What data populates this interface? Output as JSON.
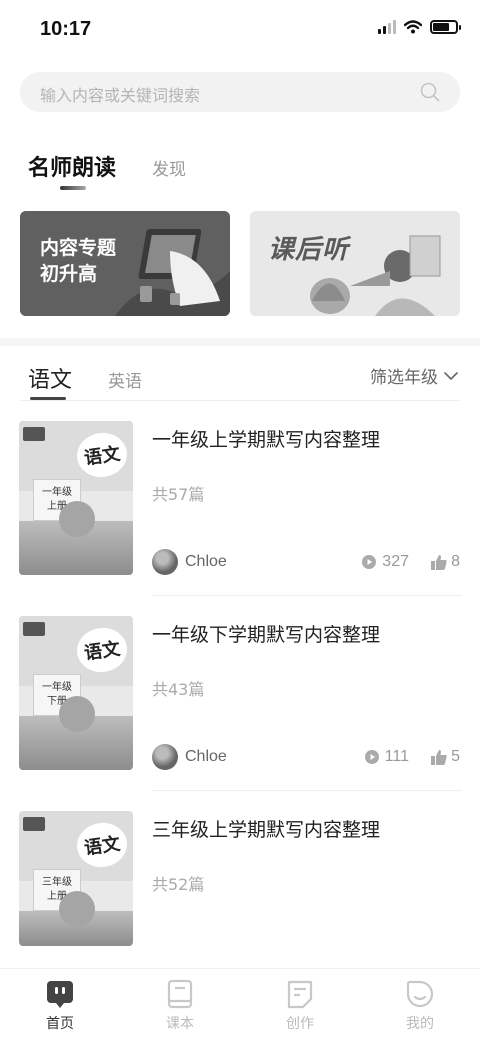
{
  "status": {
    "time": "10:17"
  },
  "search": {
    "placeholder": "输入内容或关键词搜索"
  },
  "main_tabs": [
    {
      "label": "名师朗读",
      "active": true
    },
    {
      "label": "发现",
      "active": false
    }
  ],
  "banners": [
    {
      "title_line1": "内容专题",
      "title_line2": "初升高"
    },
    {
      "title": "课后听"
    }
  ],
  "subject_tabs": [
    {
      "label": "语文",
      "active": true
    },
    {
      "label": "英语",
      "active": false
    }
  ],
  "grade_filter": {
    "label": "筛选年级"
  },
  "items": [
    {
      "title": "一年级上学期默写内容整理",
      "count": "共57篇",
      "author": "Chloe",
      "plays": "327",
      "likes": "8",
      "cover_brand": "语文",
      "cover_grade": "一年级",
      "cover_term": "上册"
    },
    {
      "title": "一年级下学期默写内容整理",
      "count": "共43篇",
      "author": "Chloe",
      "plays": "111",
      "likes": "5",
      "cover_brand": "语文",
      "cover_grade": "一年级",
      "cover_term": "下册"
    },
    {
      "title": "三年级上学期默写内容整理",
      "count": "共52篇",
      "cover_brand": "语文",
      "cover_grade": "三年级",
      "cover_term": "上册"
    }
  ],
  "bottom_nav": [
    {
      "label": "首页",
      "icon": "home-icon",
      "active": true
    },
    {
      "label": "课本",
      "icon": "book-icon",
      "active": false
    },
    {
      "label": "创作",
      "icon": "create-icon",
      "active": false
    },
    {
      "label": "我的",
      "icon": "profile-icon",
      "active": false
    }
  ],
  "colors": {
    "accent": "#333333",
    "muted": "#999999",
    "background": "#ffffff"
  }
}
